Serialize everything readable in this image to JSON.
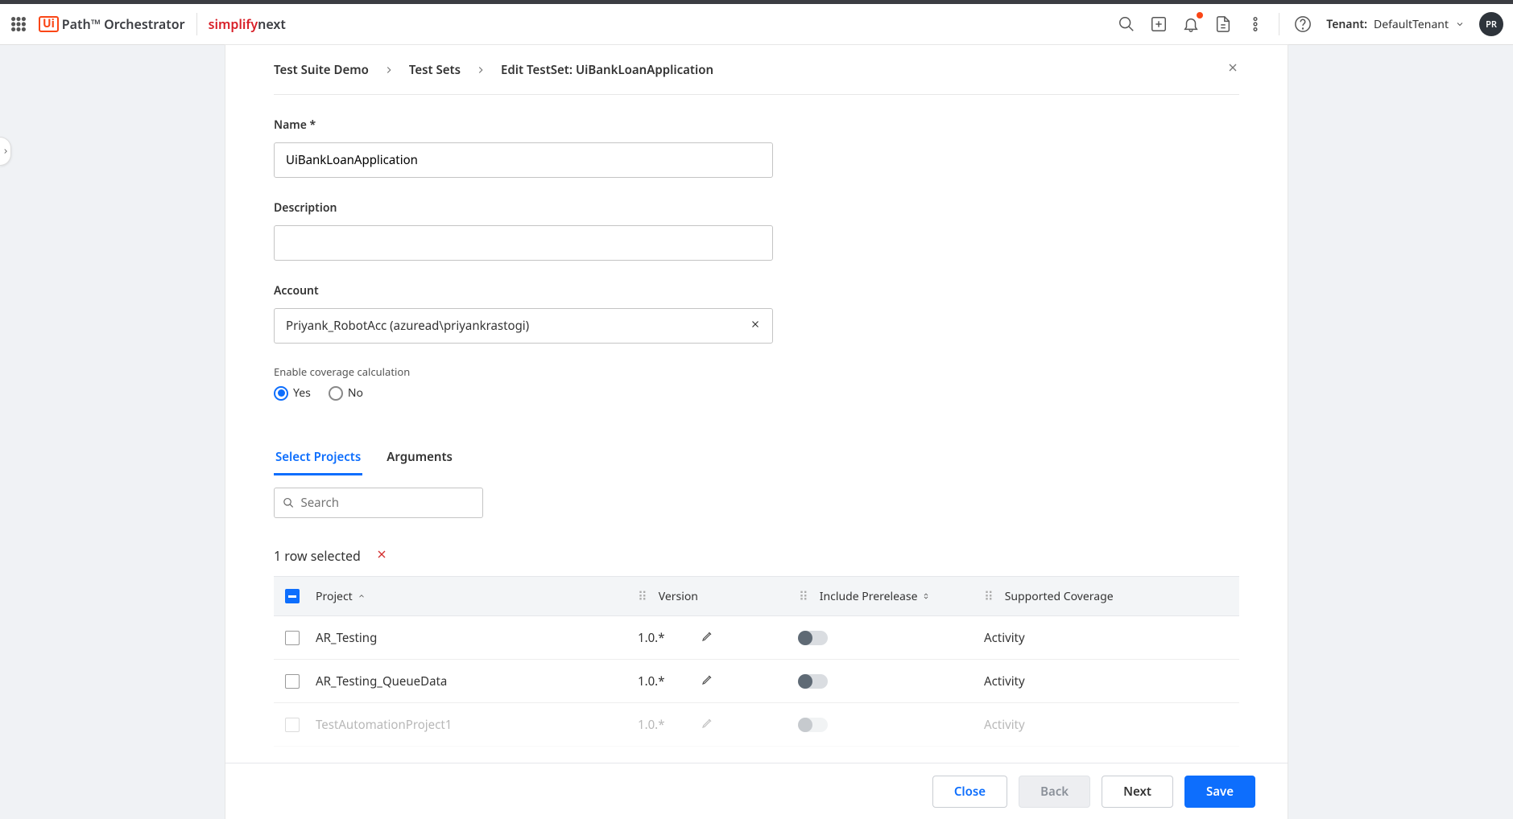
{
  "header": {
    "product": "Orchestrator",
    "partner_a": "simplify",
    "partner_b": "next",
    "tenant_label": "Tenant:",
    "tenant_value": "DefaultTenant",
    "avatar": "PR"
  },
  "breadcrumb": {
    "a": "Test Suite Demo",
    "b": "Test Sets",
    "c": "Edit TestSet: UiBankLoanApplication"
  },
  "form": {
    "name_label": "Name *",
    "name_value": "UiBankLoanApplication",
    "desc_label": "Description",
    "desc_value": "",
    "account_label": "Account",
    "account_value": "Priyank_RobotAcc (azuread\\priyankrastogi)",
    "coverage_label": "Enable coverage calculation",
    "yes": "Yes",
    "no": "No"
  },
  "tabs": {
    "select": "Select Projects",
    "arguments": "Arguments"
  },
  "search": {
    "placeholder": "Search"
  },
  "selection": {
    "text": "1 row selected"
  },
  "columns": {
    "project": "Project",
    "version": "Version",
    "prerelease": "Include Prerelease",
    "coverage": "Supported Coverage"
  },
  "rows": [
    {
      "name": "AR_Testing",
      "version": "1.0.*",
      "coverage": "Activity"
    },
    {
      "name": "AR_Testing_QueueData",
      "version": "1.0.*",
      "coverage": "Activity"
    },
    {
      "name": "TestAutomationProject1",
      "version": "1.0.*",
      "coverage": "Activity"
    }
  ],
  "footer": {
    "close": "Close",
    "back": "Back",
    "next": "Next",
    "save": "Save"
  }
}
